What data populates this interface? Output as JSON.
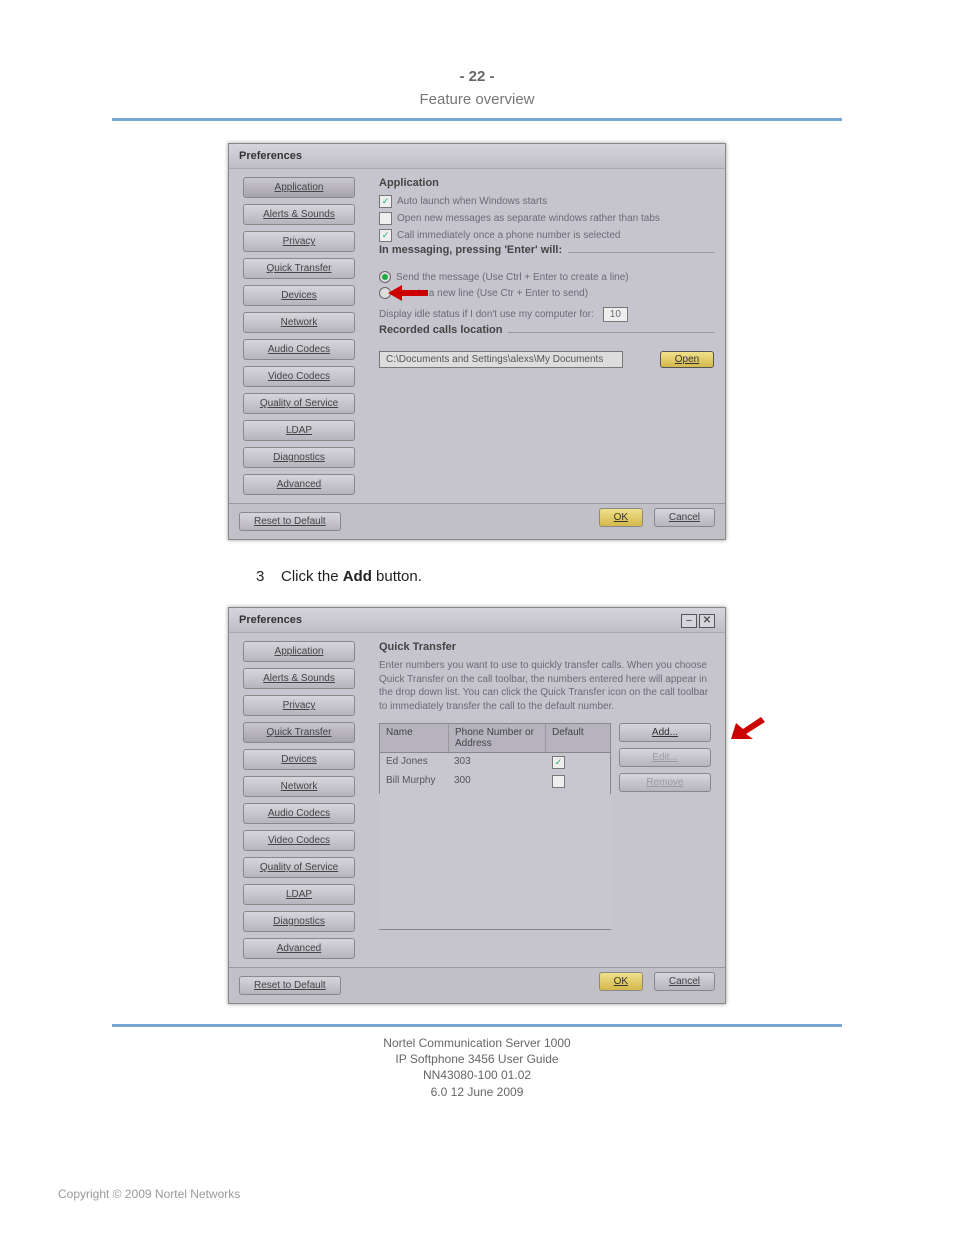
{
  "page_header": {
    "page_no": "- 22 -",
    "section": "Feature overview"
  },
  "step_line": {
    "num": "3",
    "prefix": "Click the ",
    "bold": "Add",
    "suffix": " button."
  },
  "nav_tabs": {
    "items": [
      {
        "label": "Application"
      },
      {
        "label": "Alerts & Sounds"
      },
      {
        "label": "Privacy"
      },
      {
        "label": "Quick Transfer"
      },
      {
        "label": "Devices"
      },
      {
        "label": "Network"
      },
      {
        "label": "Audio Codecs"
      },
      {
        "label": "Video Codecs"
      },
      {
        "label": "Quality of Service"
      },
      {
        "label": "LDAP"
      },
      {
        "label": "Diagnostics"
      },
      {
        "label": "Advanced"
      }
    ]
  },
  "shot1": {
    "title": "Preferences",
    "panel_title": "Application",
    "chk_autolaunch": "Auto launch when Windows starts",
    "chk_newtabs": "Open new messages as separate windows rather than tabs",
    "chk_callimm": "Call immediately once a phone number is selected",
    "sect_msg": "In messaging, pressing 'Enter' will:",
    "radio_send": "Send the message (Use Ctrl + Enter to create a line)",
    "radio_newline": "Create a new line (Use Ctr + Enter to send)",
    "idle_lbl": "Display idle status if I don't use my computer for:",
    "idle_val": "10",
    "sect_rec": "Recorded calls location",
    "path": "C:\\Documents and Settings\\alexs\\My Documents",
    "open": "Open",
    "reset": "Reset to Default",
    "ok": "OK",
    "cancel": "Cancel"
  },
  "shot2": {
    "title": "Preferences",
    "panel_title": "Quick Transfer",
    "desc": "Enter numbers you want to use to quickly transfer calls. When you choose Quick Transfer on the call toolbar, the numbers entered here will appear in the drop down list. You can click the Quick Transfer icon on the call toolbar to immediately transfer the call to the default number.",
    "cols": {
      "name": "Name",
      "addr": "Phone Number or Address",
      "def": "Default"
    },
    "rows": [
      {
        "name": "Ed Jones",
        "addr": "303",
        "def": true
      },
      {
        "name": "Bill Murphy",
        "addr": "300",
        "def": false
      }
    ],
    "btn_add": "Add...",
    "btn_edit": "Edit...",
    "btn_remove": "Remove",
    "reset": "Reset to Default",
    "ok": "OK",
    "cancel": "Cancel"
  },
  "footer": {
    "l1": "Nortel Communication Server 1000",
    "l2": "IP Softphone 3456 User Guide",
    "l3": "NN43080-100   01.02",
    "l4": "6.0   12 June 2009"
  },
  "copyright": "Copyright © 2009 Nortel Networks"
}
